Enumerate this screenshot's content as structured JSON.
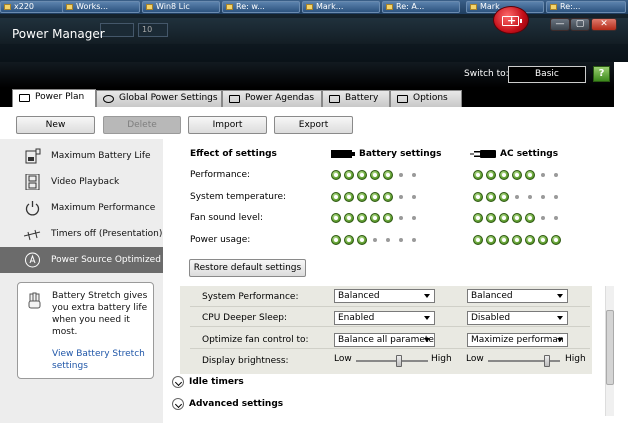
{
  "taskbar": {
    "items": [
      {
        "label": "x220"
      },
      {
        "label": "Works..."
      },
      {
        "label": "Win8 Lic"
      },
      {
        "label": "Re: w..."
      },
      {
        "label": "Mark..."
      },
      {
        "label": "Re: A..."
      },
      {
        "label": "Mark"
      },
      {
        "label": "Re:..."
      }
    ]
  },
  "window": {
    "title": "Power Manager",
    "bg_toolbar_value": "10"
  },
  "switch": {
    "label": "Switch to:",
    "value": "Basic",
    "help": "?"
  },
  "tabs": [
    {
      "label": "Power Plan",
      "icon": "power-plan-icon"
    },
    {
      "label": "Global Power Settings",
      "icon": "gear-icon"
    },
    {
      "label": "Power Agendas",
      "icon": "calendar-icon"
    },
    {
      "label": "Battery",
      "icon": "battery-icon"
    },
    {
      "label": "Options",
      "icon": "checkbox-icon"
    }
  ],
  "toolbar": {
    "new": "New",
    "delete": "Delete",
    "import": "Import",
    "export": "Export"
  },
  "sidebar": {
    "items": [
      {
        "label": "Maximum Battery Life",
        "icon": "battery-plug-icon"
      },
      {
        "label": "Video Playback",
        "icon": "film-icon"
      },
      {
        "label": "Maximum Performance",
        "icon": "power-icon"
      },
      {
        "label": "Timers off (Presentation)",
        "icon": "presentation-icon"
      },
      {
        "label": "Power Source Optimized",
        "icon": "power-source-icon"
      }
    ],
    "tip": {
      "text": "Battery Stretch gives you extra battery life when you need it most.",
      "link": "View Battery Stretch settings"
    }
  },
  "effect": {
    "heading": "Effect of settings",
    "battery_heading": "Battery settings",
    "ac_heading": "AC settings",
    "rows": [
      {
        "label": "Performance:",
        "battery": 5,
        "ac": 5
      },
      {
        "label": "System temperature:",
        "battery": 5,
        "ac": 3
      },
      {
        "label": "Fan sound level:",
        "battery": 5,
        "ac": 5
      },
      {
        "label": "Power usage:",
        "battery": 3,
        "ac": 7
      }
    ],
    "dot_total": 7,
    "restore": "Restore default settings"
  },
  "settings": {
    "rows": [
      {
        "label": "System Performance:",
        "battery": "Balanced",
        "ac": "Balanced"
      },
      {
        "label": "CPU Deeper Sleep:",
        "battery": "Enabled",
        "ac": "Disabled"
      },
      {
        "label": "Optimize fan control to:",
        "battery": "Balance all paramete",
        "ac": "Maximize performan"
      }
    ],
    "brightness": {
      "label": "Display brightness:",
      "low": "Low",
      "high": "High",
      "battery_level": 0.6,
      "ac_level": 0.85
    }
  },
  "expanders": [
    {
      "label": "Idle timers"
    },
    {
      "label": "Advanced settings"
    }
  ]
}
